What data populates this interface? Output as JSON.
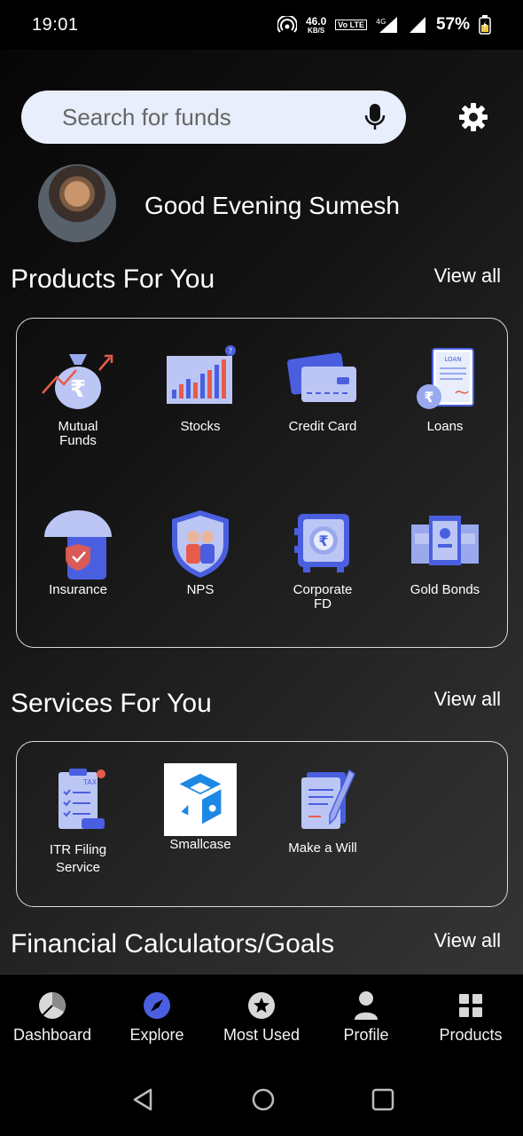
{
  "status_bar": {
    "time": "19:01",
    "net_speed_value": "46.0",
    "net_speed_unit": "KB/S",
    "volte_label": "Vo LTE",
    "battery_percent": "57%"
  },
  "search": {
    "placeholder": "Search for funds"
  },
  "user": {
    "greeting": "Good Evening Sumesh"
  },
  "products": {
    "title": "Products For You",
    "view_all": "View all",
    "items": [
      {
        "label": "Mutual Funds",
        "icon": "mutual-funds-icon"
      },
      {
        "label": "Stocks",
        "icon": "stocks-icon"
      },
      {
        "label": "Credit Card",
        "icon": "credit-card-icon"
      },
      {
        "label": "Loans",
        "icon": "loans-icon"
      },
      {
        "label": "Insurance",
        "icon": "insurance-icon"
      },
      {
        "label": "NPS",
        "icon": "nps-icon"
      },
      {
        "label": "Corporate FD",
        "icon": "corporate-fd-icon"
      },
      {
        "label": "Gold Bonds",
        "icon": "gold-bonds-icon"
      }
    ]
  },
  "services": {
    "title": "Services For You",
    "view_all": "View all",
    "items": [
      {
        "label": "ITR Filing Service",
        "icon": "itr-filing-icon"
      },
      {
        "label": "Smallcase",
        "icon": "smallcase-icon"
      },
      {
        "label": "Make a Will",
        "icon": "make-a-will-icon"
      }
    ]
  },
  "calculators": {
    "title": "Financial Calculators/Goals",
    "view_all": "View all"
  },
  "bottom_nav": {
    "items": [
      {
        "label": "Dashboard",
        "icon": "pie-chart-icon"
      },
      {
        "label": "Explore",
        "icon": "compass-icon",
        "active": true
      },
      {
        "label": "Most Used",
        "icon": "star-icon"
      },
      {
        "label": "Profile",
        "icon": "person-icon"
      },
      {
        "label": "Products",
        "icon": "grid-icon"
      }
    ]
  },
  "colors": {
    "accent": "#4a5fe0",
    "icon_light": "#bcc6f5",
    "search_bg": "#e8eefb"
  }
}
